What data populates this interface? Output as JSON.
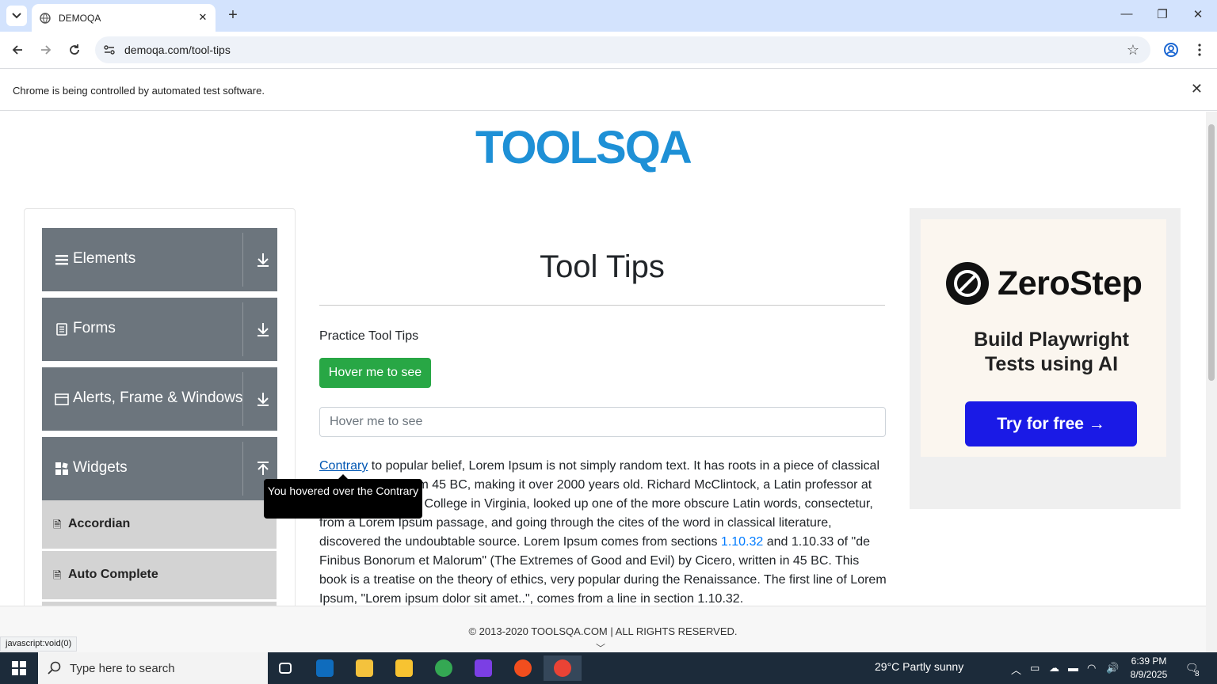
{
  "browser": {
    "tab_title": "DEMOQA",
    "url": "demoqa.com/tool-tips",
    "infobar_message": "Chrome is being controlled by automated test software.",
    "status_url": "javascript:void(0)"
  },
  "header": {
    "logo_text": "TOOLSQA"
  },
  "sidebar": {
    "groups": [
      {
        "label": "Elements",
        "icon": "hamburger-icon",
        "expanded": false
      },
      {
        "label": "Forms",
        "icon": "document-icon",
        "expanded": false
      },
      {
        "label": "Alerts, Frame & Windows",
        "icon": "window-icon",
        "expanded": false
      },
      {
        "label": "Widgets",
        "icon": "grid-icon",
        "expanded": true
      }
    ],
    "widget_items": [
      {
        "label": "Accordian"
      },
      {
        "label": "Auto Complete"
      }
    ]
  },
  "main": {
    "title": "Tool Tips",
    "subtitle": "Practice Tool Tips",
    "hover_button": "Hover me to see",
    "hover_input_placeholder": "Hover me to see",
    "paragraph": {
      "link_contrary": "Contrary",
      "text_1": " to popular belief, Lorem Ipsum is not simply random text. It has roots in a piece of classical Latin literature from 45 BC, making it over 2000 years old. Richard McClintock, a Latin professor at Hampden-Sydney College in Virginia, looked up one of the more obscure Latin words, consectetur, from a Lorem Ipsum passage, and going through the cites of the word in classical literature, discovered the undoubtable source. Lorem Ipsum comes from sections ",
      "link_section": "1.10.32",
      "text_2": " and 1.10.33 of \"de Finibus Bonorum et Malorum\" (The Extremes of Good and Evil) by Cicero, written in 45 BC. This book is a treatise on the theory of ethics, very popular during the Renaissance. The first line of Lorem Ipsum, \"Lorem ipsum dolor sit amet..\", comes from a line in section 1.10.32."
    },
    "tooltip": "You hovered over the Contrary"
  },
  "ad": {
    "brand": "ZeroStep",
    "headline_1": "Build Playwright",
    "headline_2": "Tests using AI",
    "cta": "Try for free →"
  },
  "footer": {
    "copyright": "© 2013-2020 TOOLSQA.COM | ALL RIGHTS RESERVED."
  },
  "taskbar": {
    "search_placeholder": "Type here to search",
    "weather": "29°C  Partly sunny",
    "time": "6:39 PM",
    "date": "8/9/2025",
    "notification_count": "8"
  },
  "colors": {
    "sidebar_group": "#6c757d",
    "button_green": "#28a745",
    "link_blue": "#007bff",
    "ad_cta": "#1a1ae6",
    "logo_blue": "#1e90d6"
  }
}
